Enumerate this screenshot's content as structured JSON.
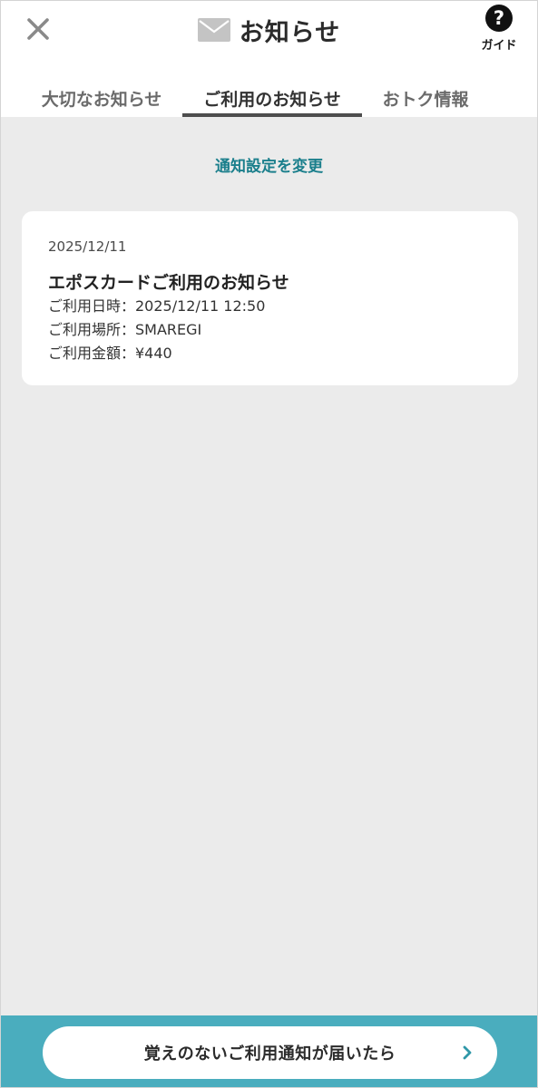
{
  "header": {
    "title": "お知らせ",
    "guide_label": "ガイド",
    "guide_icon_glyph": "?"
  },
  "tabs": [
    {
      "label": "大切なお知らせ",
      "active": false
    },
    {
      "label": "ご利用のお知らせ",
      "active": true
    },
    {
      "label": "おトク情報",
      "active": false
    }
  ],
  "settings_link": "通知設定を変更",
  "notifications": [
    {
      "date": "2025/12/11",
      "title": "エポスカードご利用のお知らせ",
      "lines": [
        "ご利用日時：2025/12/11 12:50",
        "ご利用場所：SMAREGI",
        "ご利用金額：¥440"
      ]
    }
  ],
  "bottom_button": {
    "label": "覚えのないご利用通知が届いたら"
  },
  "icons": {
    "close": "close-icon",
    "mail": "mail-icon",
    "guide": "question-circle-icon",
    "chevron": "chevron-right-icon"
  },
  "colors": {
    "accent": "#1b7f8c",
    "bottom_bar": "#4aadbe",
    "background": "#ebebeb"
  }
}
